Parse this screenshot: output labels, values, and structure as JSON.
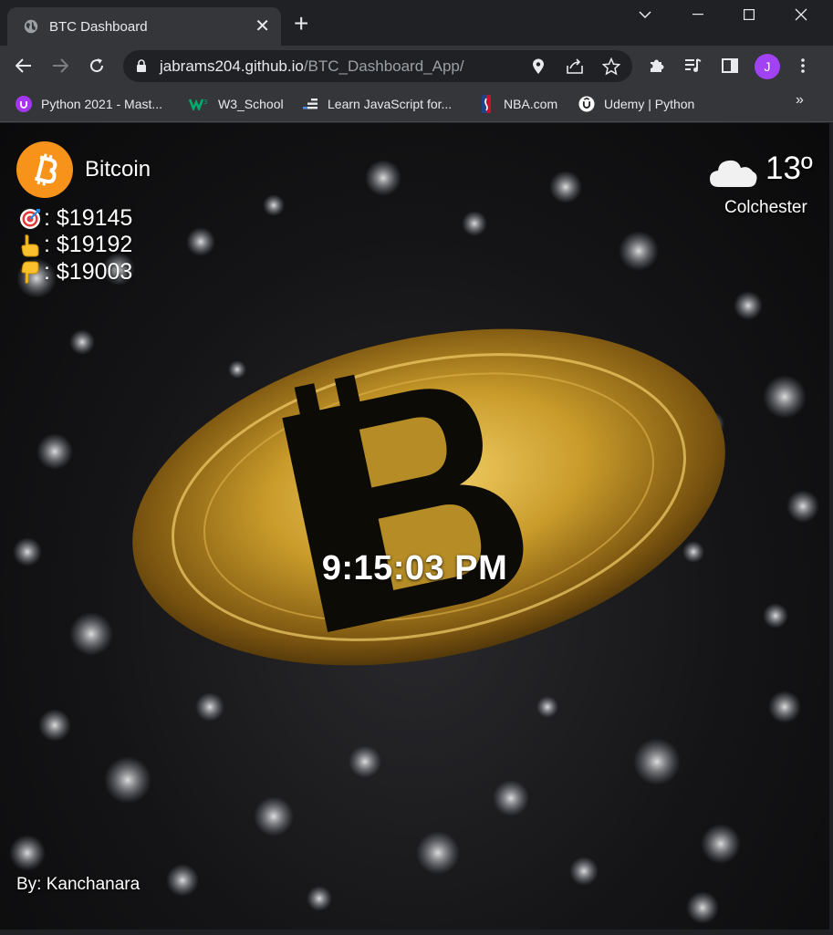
{
  "browser": {
    "tab_title": "BTC Dashboard",
    "url_host": "jabrams204.github.io",
    "url_path": "/BTC_Dashboard_App/",
    "profile_initial": "J",
    "bookmarks": [
      {
        "label": "Python 2021 - Mast...",
        "icon": "udemy-icon"
      },
      {
        "label": "W3_School",
        "icon": "w3schools-icon"
      },
      {
        "label": "Learn JavaScript for...",
        "icon": "freecodecamp-icon"
      },
      {
        "label": "NBA.com",
        "icon": "nba-icon"
      },
      {
        "label": "Udemy | Python",
        "icon": "udemy-icon"
      }
    ]
  },
  "dashboard": {
    "coin_name": "Bitcoin",
    "current_price": ": $19145",
    "high_price": ": $19192",
    "low_price": ": $19003",
    "temperature": "13º",
    "city": "Colchester",
    "time": "9:15:03 PM",
    "author": "By: Kanchanara"
  },
  "colors": {
    "bitcoin_orange": "#f7931a",
    "chrome_dark": "#202124",
    "chrome_toolbar": "#35363a",
    "profile_purple": "#a142f4"
  }
}
